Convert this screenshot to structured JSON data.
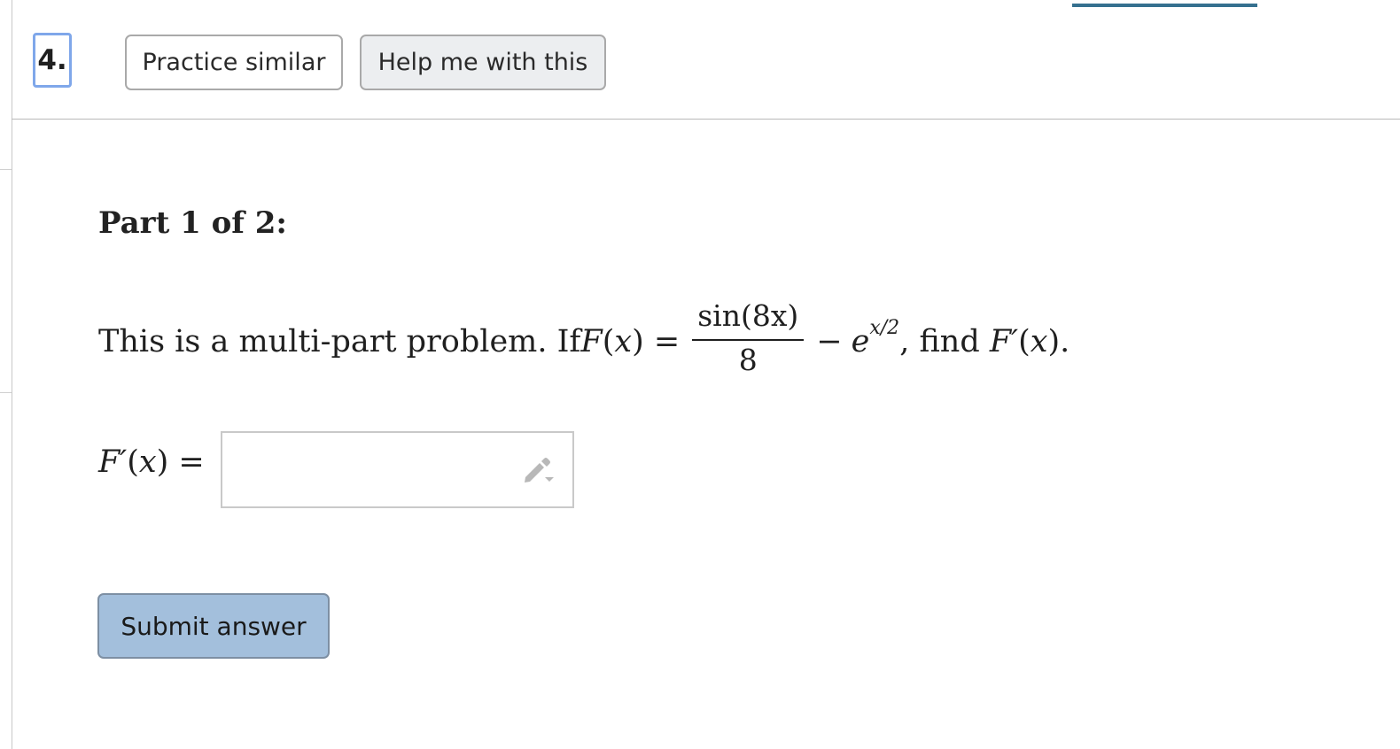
{
  "question": {
    "number": "4."
  },
  "header": {
    "practice_label": "Practice similar",
    "help_label": "Help me with this"
  },
  "part": {
    "label": "Part 1 of 2:"
  },
  "problem": {
    "intro": "This is a multi-part problem. If ",
    "F": "F",
    "x": "x",
    "open_paren": "(",
    "close_paren_eq": ") =",
    "frac_num": "sin(8x)",
    "frac_den": "8",
    "minus": "−",
    "e": "e",
    "exp": "x/2",
    "find": ", find ",
    "Fprime": "F′",
    "end": ")."
  },
  "answer": {
    "label_F": "F′",
    "label_x": "x",
    "label_open": "(",
    "label_close": ") =",
    "value": "",
    "placeholder": ""
  },
  "submit": {
    "label": "Submit answer"
  },
  "colors": {
    "accent_progress": "#35708f",
    "question_number_border": "#7fa7ea",
    "submit_background": "#a3bfdc",
    "help_background": "#eceef0"
  },
  "icons": {
    "input_tool": "pencil-icon"
  }
}
